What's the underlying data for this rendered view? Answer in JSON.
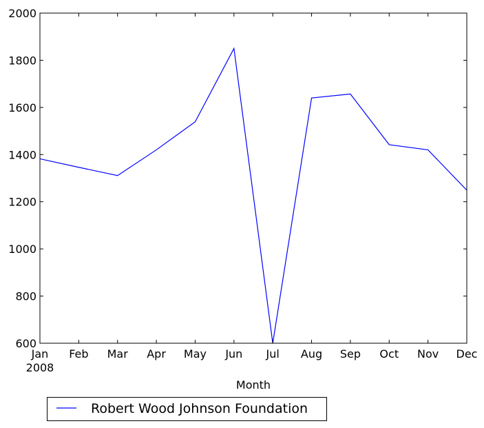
{
  "chart_data": {
    "type": "line",
    "title": "",
    "xlabel": "Month",
    "ylabel": "",
    "categories": [
      "Jan",
      "Feb",
      "Mar",
      "Apr",
      "May",
      "Jun",
      "Jul",
      "Aug",
      "Sep",
      "Oct",
      "Nov",
      "Dec"
    ],
    "x_sub_label": "2008",
    "ylim": [
      600,
      2000
    ],
    "yticks": [
      600,
      800,
      1000,
      1200,
      1400,
      1600,
      1800,
      2000
    ],
    "grid": false,
    "legend_position": "below-left",
    "series": [
      {
        "name": "Robert Wood Johnson Foundation",
        "color": "#0000ff",
        "values": [
          1382,
          1346,
          1311,
          1420,
          1539,
          1850,
          600,
          1640,
          1657,
          1442,
          1420,
          1249
        ]
      }
    ]
  }
}
